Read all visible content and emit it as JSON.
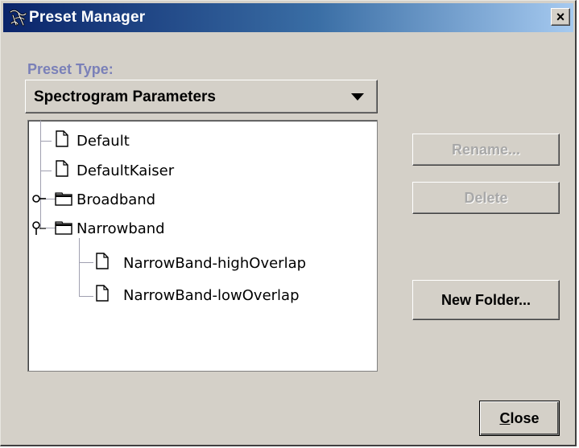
{
  "window": {
    "title": "Preset Manager",
    "close_glyph": "×"
  },
  "preset_type": {
    "label": "Preset Type:",
    "selected": "Spectrogram Parameters"
  },
  "tree": {
    "items": [
      {
        "label": "Default",
        "type": "preset",
        "icon": "document-icon"
      },
      {
        "label": "DefaultKaiser",
        "type": "preset",
        "icon": "document-icon"
      },
      {
        "label": "Broadband",
        "type": "folder",
        "icon": "folder-icon",
        "expanded": false
      },
      {
        "label": "Narrowband",
        "type": "folder",
        "icon": "folder-icon",
        "expanded": true,
        "children": [
          {
            "label": "NarrowBand-highOverlap",
            "type": "preset",
            "icon": "document-icon"
          },
          {
            "label": "NarrowBand-lowOverlap",
            "type": "preset",
            "icon": "document-icon"
          }
        ]
      }
    ]
  },
  "buttons": {
    "rename": {
      "label": "Rename...",
      "enabled": false
    },
    "delete": {
      "label": "Delete",
      "enabled": false
    },
    "new_folder": {
      "label": "New Folder...",
      "enabled": true
    },
    "close": {
      "label": "Close",
      "mnemonic": "C"
    }
  },
  "colors": {
    "title_gradient_start": "#0a246a",
    "title_gradient_end": "#a6caf0",
    "window_bg": "#d4d0c8",
    "label_accent": "#7a80b8"
  }
}
